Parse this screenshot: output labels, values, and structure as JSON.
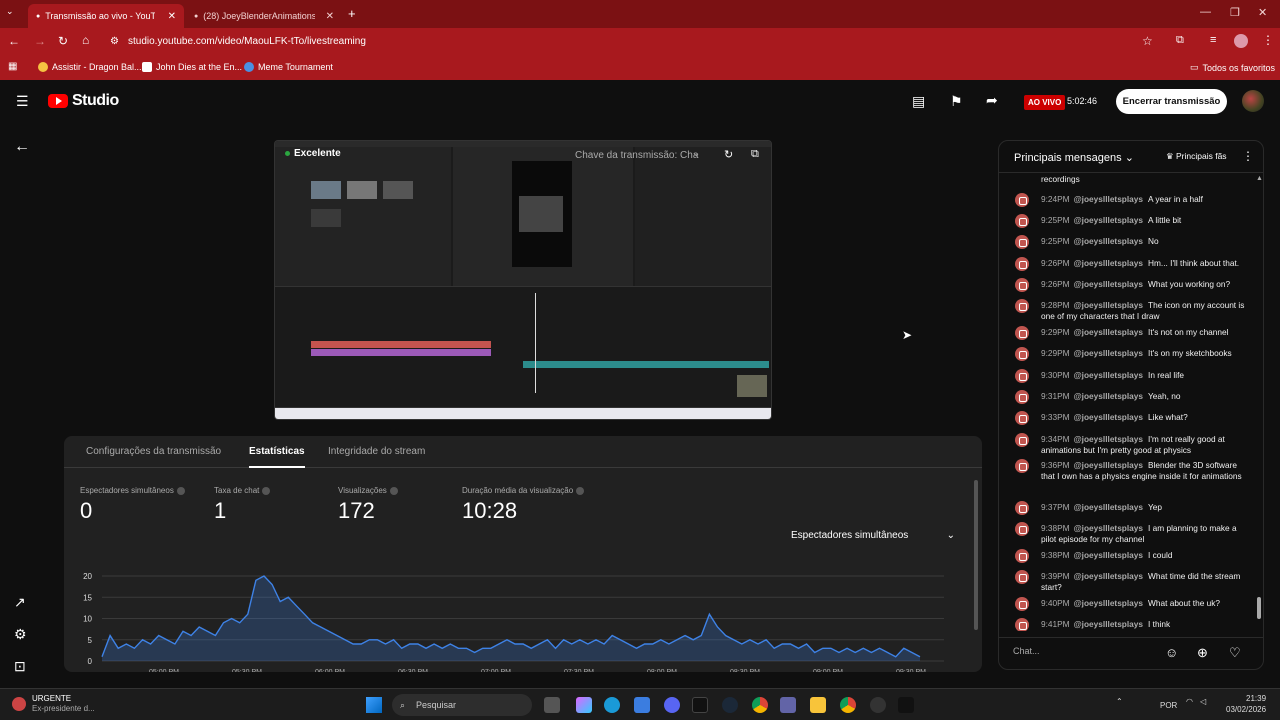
{
  "browser": {
    "tabs": [
      {
        "title": "Transmissão ao vivo - YouTube",
        "active": true
      },
      {
        "title": "(28) JoeyBlenderAnimations - Y",
        "active": false
      }
    ],
    "url": "studio.youtube.com/video/MaouLFK-tTo/livestreaming",
    "bookmarks": [
      "Assistir - Dragon Bal...",
      "John Dies at the En...",
      "Meme Tournament"
    ],
    "bookmarks_folder": "Todos os favoritos"
  },
  "header": {
    "logo_text": "Studio",
    "live_badge": "AO VIVO",
    "live_time": "5:02:46",
    "end_button": "Encerrar transmissão"
  },
  "preview": {
    "status": "Excelente",
    "stream_key_label": "Chave da transmissão: Cha"
  },
  "stats": {
    "tabs": [
      "Configurações da transmissão",
      "Estatísticas",
      "Integridade do stream"
    ],
    "active_tab": "Estatísticas",
    "metrics": [
      {
        "label": "Espectadores simultâneos",
        "value": "0"
      },
      {
        "label": "Taxa de chat",
        "value": "1"
      },
      {
        "label": "Visualizações",
        "value": "172"
      },
      {
        "label": "Duração média da visualização",
        "value": "10:28"
      }
    ],
    "dropdown": "Espectadores simultâneos"
  },
  "chart_data": {
    "type": "area",
    "ylim": [
      0,
      20
    ],
    "yticks": [
      "20",
      "15",
      "10",
      "5",
      "0"
    ],
    "xticks": [
      "05:00 PM",
      "05:30 PM",
      "06:00 PM",
      "06:30 PM",
      "07:00 PM",
      "07:30 PM",
      "08:00 PM",
      "08:30 PM",
      "09:00 PM",
      "09:30 PM"
    ],
    "series": [
      {
        "values": [
          1,
          6,
          3,
          4,
          3,
          5,
          4,
          6,
          5,
          4,
          7,
          6,
          8,
          7,
          6,
          9,
          10,
          9,
          11,
          19,
          20,
          18,
          14,
          15,
          13,
          11,
          9,
          8,
          7,
          6,
          5,
          4,
          4,
          5,
          5,
          4,
          5,
          3,
          4,
          4,
          3,
          4,
          3,
          4,
          3,
          3,
          2,
          3,
          3,
          4,
          5,
          4,
          4,
          3,
          4,
          5,
          3,
          5,
          4,
          5,
          4,
          5,
          4,
          6,
          5,
          4,
          3,
          4,
          4,
          5,
          4,
          5,
          6,
          5,
          6,
          11,
          8,
          6,
          5,
          4,
          5,
          4,
          5,
          3,
          4,
          4,
          3,
          4,
          2,
          3,
          3,
          2,
          3,
          2,
          3,
          2,
          3,
          2,
          1,
          3,
          2,
          1
        ]
      }
    ]
  },
  "chat": {
    "title": "Principais mensagens",
    "filter": "Principais fãs",
    "placeholder": "Chat...",
    "messages": [
      {
        "time": "",
        "author": "",
        "text": "recordings"
      },
      {
        "time": "9:24PM",
        "author": "@joeysllletsplays",
        "text": "A year in a half"
      },
      {
        "time": "9:25PM",
        "author": "@joeysllletsplays",
        "text": "A little bit"
      },
      {
        "time": "9:25PM",
        "author": "@joeysllletsplays",
        "text": "No"
      },
      {
        "time": "9:26PM",
        "author": "@joeysllletsplays",
        "text": "Hm... I'll think about that."
      },
      {
        "time": "9:26PM",
        "author": "@joeysllletsplays",
        "text": "What you working on?"
      },
      {
        "time": "9:28PM",
        "author": "@joeysllletsplays",
        "text": "The icon on my account is one of my characters that I draw"
      },
      {
        "time": "9:29PM",
        "author": "@joeysllletsplays",
        "text": "It's not on my channel"
      },
      {
        "time": "9:29PM",
        "author": "@joeysllletsplays",
        "text": "It's on my sketchbooks"
      },
      {
        "time": "9:30PM",
        "author": "@joeysllletsplays",
        "text": "In real life"
      },
      {
        "time": "9:31PM",
        "author": "@joeysllletsplays",
        "text": "Yeah, no"
      },
      {
        "time": "9:33PM",
        "author": "@joeysllletsplays",
        "text": "Like what?"
      },
      {
        "time": "9:34PM",
        "author": "@joeysllletsplays",
        "text": "I'm not really good at animations but I'm pretty good at physics"
      },
      {
        "time": "9:36PM",
        "author": "@joeysllletsplays",
        "text": "Blender the 3D software that I own has a physics engine inside it for animations"
      },
      {
        "time": "9:37PM",
        "author": "@joeysllletsplays",
        "text": "Yep"
      },
      {
        "time": "9:38PM",
        "author": "@joeysllletsplays",
        "text": "I am planning to make a pilot episode for my channel"
      },
      {
        "time": "9:38PM",
        "author": "@joeysllletsplays",
        "text": "I could"
      },
      {
        "time": "9:39PM",
        "author": "@joeysllletsplays",
        "text": "What time did the stream start?"
      },
      {
        "time": "9:40PM",
        "author": "@joeysllletsplays",
        "text": "What about the uk?"
      },
      {
        "time": "9:41PM",
        "author": "@joeysllletsplays",
        "text": "I think"
      }
    ]
  },
  "taskbar": {
    "news_title": "URGENTE",
    "news_sub": "Ex-presidente d...",
    "search": "Pesquisar",
    "lang": "POR",
    "time": "21:39",
    "date": "03/02/2026"
  }
}
